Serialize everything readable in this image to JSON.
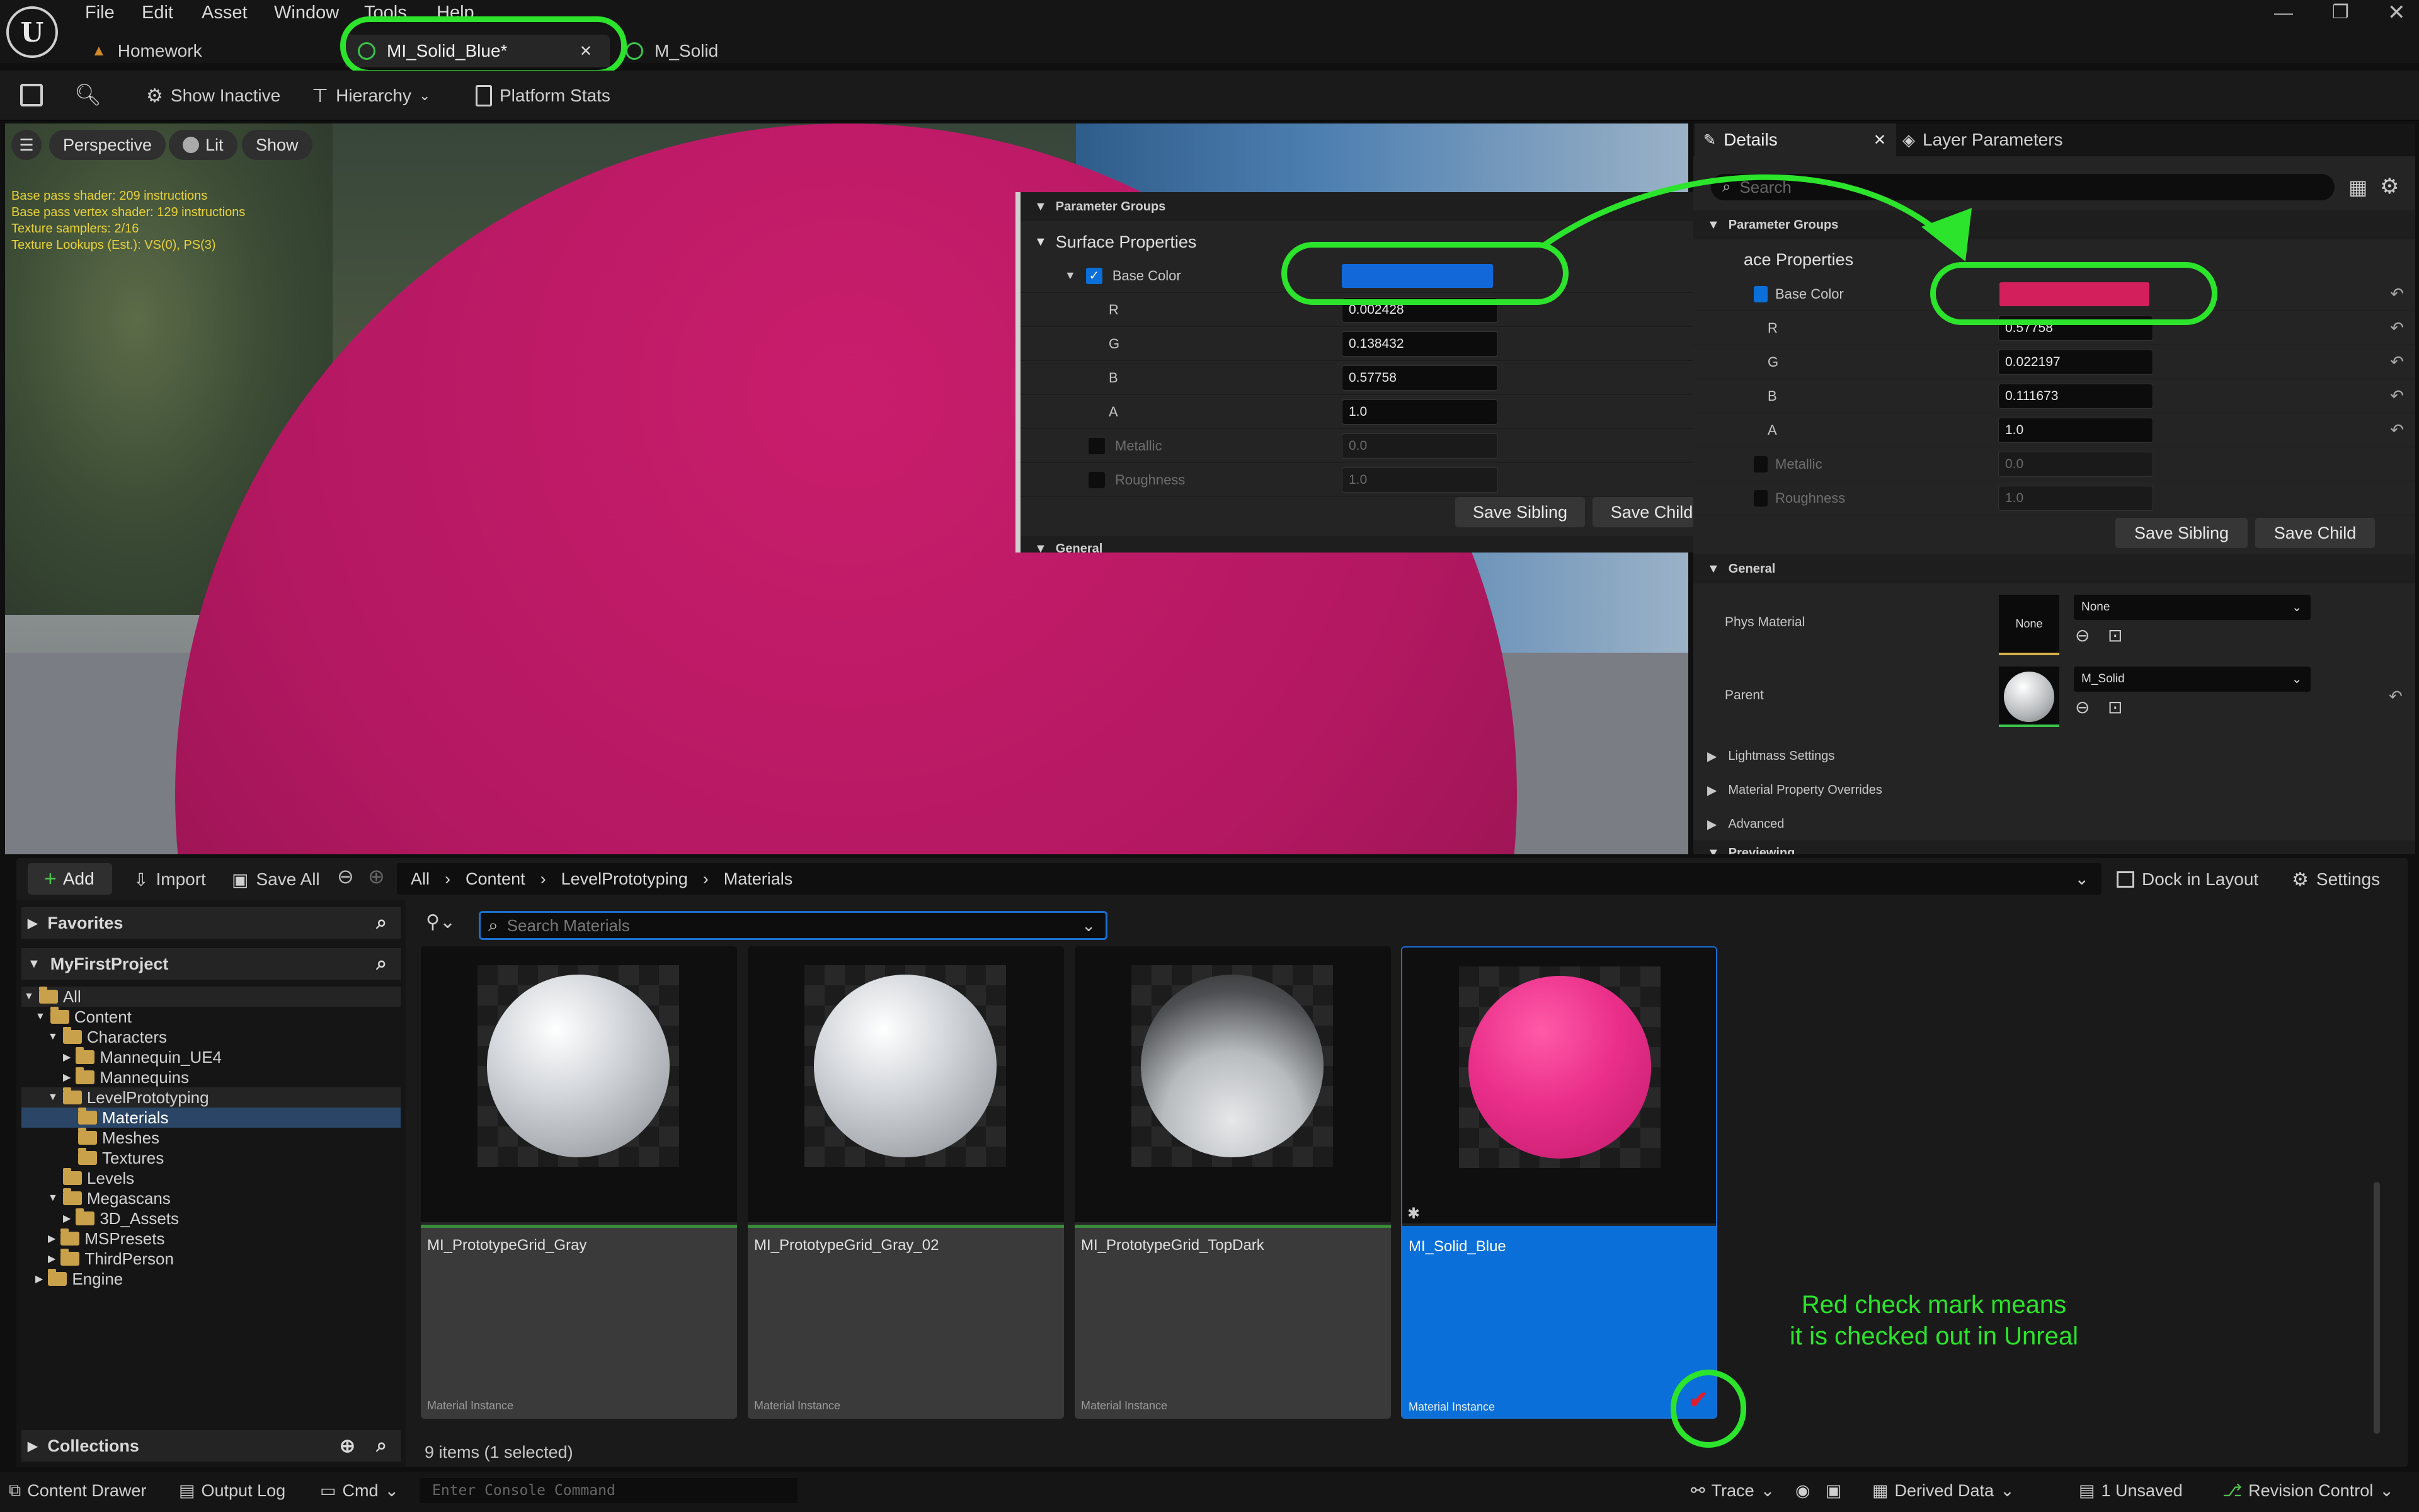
{
  "menu": [
    "File",
    "Edit",
    "Asset",
    "Window",
    "Tools",
    "Help"
  ],
  "tabs": [
    {
      "label": "Homework",
      "active": false
    },
    {
      "label": "MI_Solid_Blue*",
      "active": true
    },
    {
      "label": "M_Solid",
      "active": false
    }
  ],
  "toolbar": {
    "show_inactive": "Show Inactive",
    "hierarchy": "Hierarchy",
    "platform_stats": "Platform Stats"
  },
  "viewport": {
    "perspective": "Perspective",
    "lit": "Lit",
    "show": "Show",
    "stats": [
      "Base pass shader: 209 instructions",
      "Base pass vertex shader: 129 instructions",
      "Texture samplers: 2/16",
      "Texture Lookups (Est.): VS(0), PS(3)"
    ],
    "sphere_color": "#b8185f"
  },
  "overlay_panel": {
    "parameter_groups": "Parameter Groups",
    "surface_properties": "Surface Properties",
    "base_color": "Base Color",
    "swatch_color": "#1268d8",
    "channels": [
      {
        "label": "R",
        "value": "0.002428"
      },
      {
        "label": "G",
        "value": "0.138432"
      },
      {
        "label": "B",
        "value": "0.57758"
      },
      {
        "label": "A",
        "value": "1.0"
      }
    ],
    "metallic": {
      "label": "Metallic",
      "value": "0.0"
    },
    "roughness": {
      "label": "Roughness",
      "value": "1.0"
    },
    "save_sibling": "Save Sibling",
    "save_child": "Save Child",
    "general": "General"
  },
  "details": {
    "tab_details": "Details",
    "tab_layer": "Layer Parameters",
    "search_placeholder": "Search",
    "parameter_groups": "Parameter Groups",
    "surface_properties": "ace Properties",
    "base_color": "Base Color",
    "swatch_color": "#d31f5c",
    "channels": [
      {
        "label": "R",
        "value": "0.57758"
      },
      {
        "label": "G",
        "value": "0.022197"
      },
      {
        "label": "B",
        "value": "0.111673"
      },
      {
        "label": "A",
        "value": "1.0"
      }
    ],
    "metallic": {
      "label": "Metallic",
      "value": "0.0"
    },
    "roughness": {
      "label": "Roughness",
      "value": "1.0"
    },
    "save_sibling": "Save Sibling",
    "save_child": "Save Child",
    "general": "General",
    "phys_material": "Phys Material",
    "phys_value": "None",
    "phys_thumb": "None",
    "parent": "Parent",
    "parent_value": "M_Solid",
    "sections": [
      "Lightmass Settings",
      "Material Property Overrides",
      "Advanced"
    ],
    "previewing": "Previewing"
  },
  "content_browser": {
    "add": "Add",
    "import": "Import",
    "save_all": "Save All",
    "breadcrumb": [
      "All",
      "Content",
      "LevelPrototyping",
      "Materials"
    ],
    "dock": "Dock in Layout",
    "settings": "Settings",
    "favorites": "Favorites",
    "project": "MyFirstProject",
    "search_placeholder": "Search Materials",
    "tree": [
      {
        "label": "All",
        "depth": 0,
        "arrow": "▼"
      },
      {
        "label": "Content",
        "depth": 1,
        "arrow": "▼"
      },
      {
        "label": "Characters",
        "depth": 2,
        "arrow": "▼"
      },
      {
        "label": "Mannequin_UE4",
        "depth": 3,
        "arrow": "▶"
      },
      {
        "label": "Mannequins",
        "depth": 3,
        "arrow": "▶"
      },
      {
        "label": "LevelPrototyping",
        "depth": 2,
        "arrow": "▼"
      },
      {
        "label": "Materials",
        "depth": 3,
        "arrow": ""
      },
      {
        "label": "Meshes",
        "depth": 3,
        "arrow": ""
      },
      {
        "label": "Textures",
        "depth": 3,
        "arrow": ""
      },
      {
        "label": "Levels",
        "depth": 2,
        "arrow": ""
      },
      {
        "label": "Megascans",
        "depth": 2,
        "arrow": "▼"
      },
      {
        "label": "3D_Assets",
        "depth": 3,
        "arrow": "▶"
      },
      {
        "label": "MSPresets",
        "depth": 2,
        "arrow": "▶"
      },
      {
        "label": "ThirdPerson",
        "depth": 2,
        "arrow": "▶"
      },
      {
        "label": "Engine",
        "depth": 1,
        "arrow": "▶"
      }
    ],
    "assets": [
      {
        "name": "MI_PrototypeGrid_Gray",
        "kind": "Material Instance",
        "selected": false
      },
      {
        "name": "MI_PrototypeGrid_Gray_02",
        "kind": "Material Instance",
        "selected": false
      },
      {
        "name": "MI_PrototypeGrid_TopDark",
        "kind": "Material Instance",
        "selected": false
      },
      {
        "name": "MI_Solid_Blue",
        "kind": "Material Instance",
        "selected": true
      }
    ],
    "item_count": "9 items (1 selected)",
    "collections": "Collections",
    "annotation": [
      "Red check mark means",
      "it is checked out in Unreal"
    ]
  },
  "statusbar": {
    "content_drawer": "Content Drawer",
    "output_log": "Output Log",
    "cmd": "Cmd",
    "console_placeholder": "Enter Console Command",
    "trace": "Trace",
    "derived_data": "Derived Data",
    "unsaved": "1 Unsaved",
    "revision": "Revision Control"
  },
  "colors": {
    "accent_blue": "#0a6fd8",
    "annotation_green": "#2be42b",
    "selection": "#1a3a5c"
  }
}
